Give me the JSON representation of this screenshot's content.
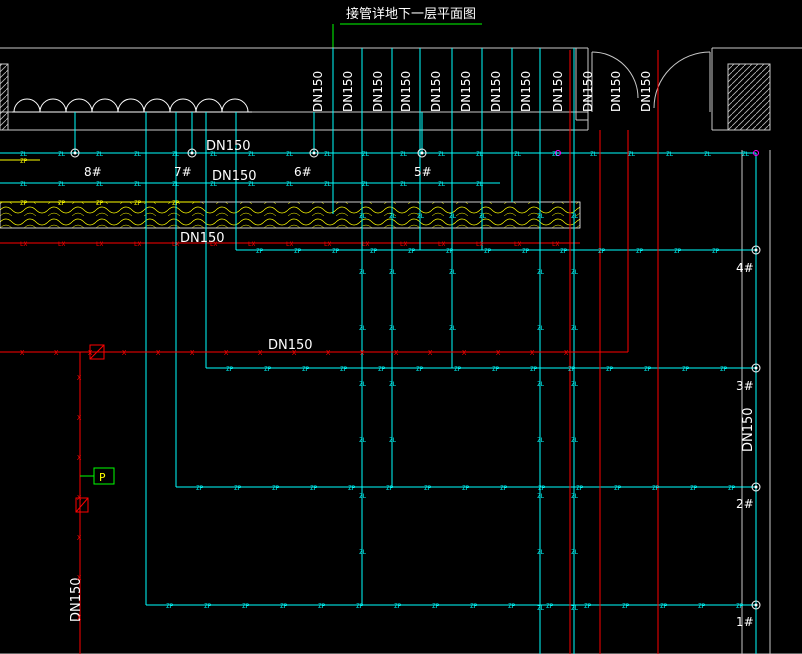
{
  "title": "接管详地下一层平面图",
  "pipe_size_label": "DN150",
  "tags": {
    "zl": "ZL",
    "zp": "ZP",
    "lx": "LX",
    "x": "X",
    "p": "P"
  },
  "tanks": [
    {
      "label": "8#"
    },
    {
      "label": "7#"
    },
    {
      "label": "6#"
    },
    {
      "label": "5#"
    }
  ],
  "risers": [
    {
      "label": "4#"
    },
    {
      "label": "3#"
    },
    {
      "label": "2#"
    },
    {
      "label": "1#"
    }
  ],
  "colors": {
    "cyan": "#00ffff",
    "red": "#ff0000",
    "yellow": "#ffff00",
    "white": "#ffffff",
    "green": "#00ff00",
    "magenta": "#ff00ff",
    "wall": "#c8c8c8"
  }
}
